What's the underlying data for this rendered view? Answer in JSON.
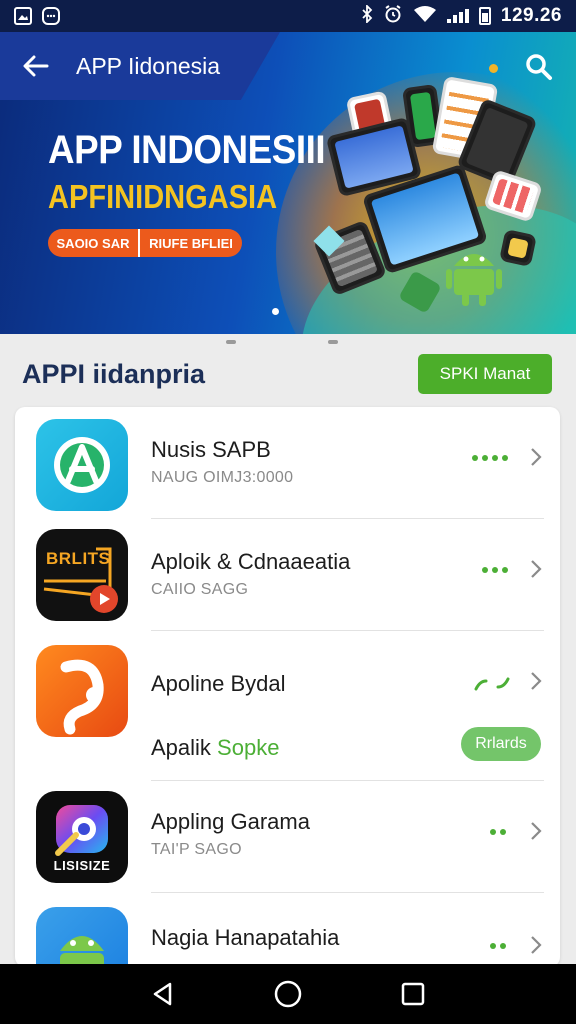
{
  "status_bar": {
    "time": "129.26",
    "left_icons": [
      "gallery-icon",
      "message-icon"
    ],
    "right_icons": [
      "bluetooth-icon",
      "alarm-icon",
      "wifi-icon",
      "signal-icon",
      "battery-icon"
    ]
  },
  "app_bar": {
    "title": "APP Iidonesia",
    "back_icon": "arrow-left-icon",
    "search_icon": "search-icon"
  },
  "banner": {
    "title": "APP INDONESIII",
    "subtitle": "APFINIDNGASIA",
    "pill_left": "SAOIO SAR",
    "pill_right": "RIUFE BFLIEI"
  },
  "section": {
    "title": "APPI iidanpria",
    "button_label": "SPKI Manat"
  },
  "apps": [
    {
      "name": "Nusis SAPB",
      "sub": "NAUG OIMJ3:0000",
      "dot_count": 4
    },
    {
      "name": "Aploik & Cdnaaeatia",
      "sub": "CAIIO SAGG",
      "dot_count": 3
    },
    {
      "name": "Apoline Bydal",
      "secondary_name": "Apalik",
      "secondary_tag": "Sopke",
      "badge": "Rrlards"
    },
    {
      "name": "Appling Garama",
      "sub": "TAI'P SAGO",
      "dot_count": 2,
      "icon_text": "LISISIZE"
    },
    {
      "name": "Nagia Hanapatahia",
      "sub": "",
      "dot_count": 2
    }
  ],
  "app_icon_texts": {
    "app2": "BRLITS"
  },
  "nav": [
    "back-icon",
    "home-icon",
    "recents-icon"
  ],
  "colors": {
    "accent_green": "#4cae2a",
    "banner_blue": "#0d4fb8",
    "title_navy": "#1c2f58"
  }
}
